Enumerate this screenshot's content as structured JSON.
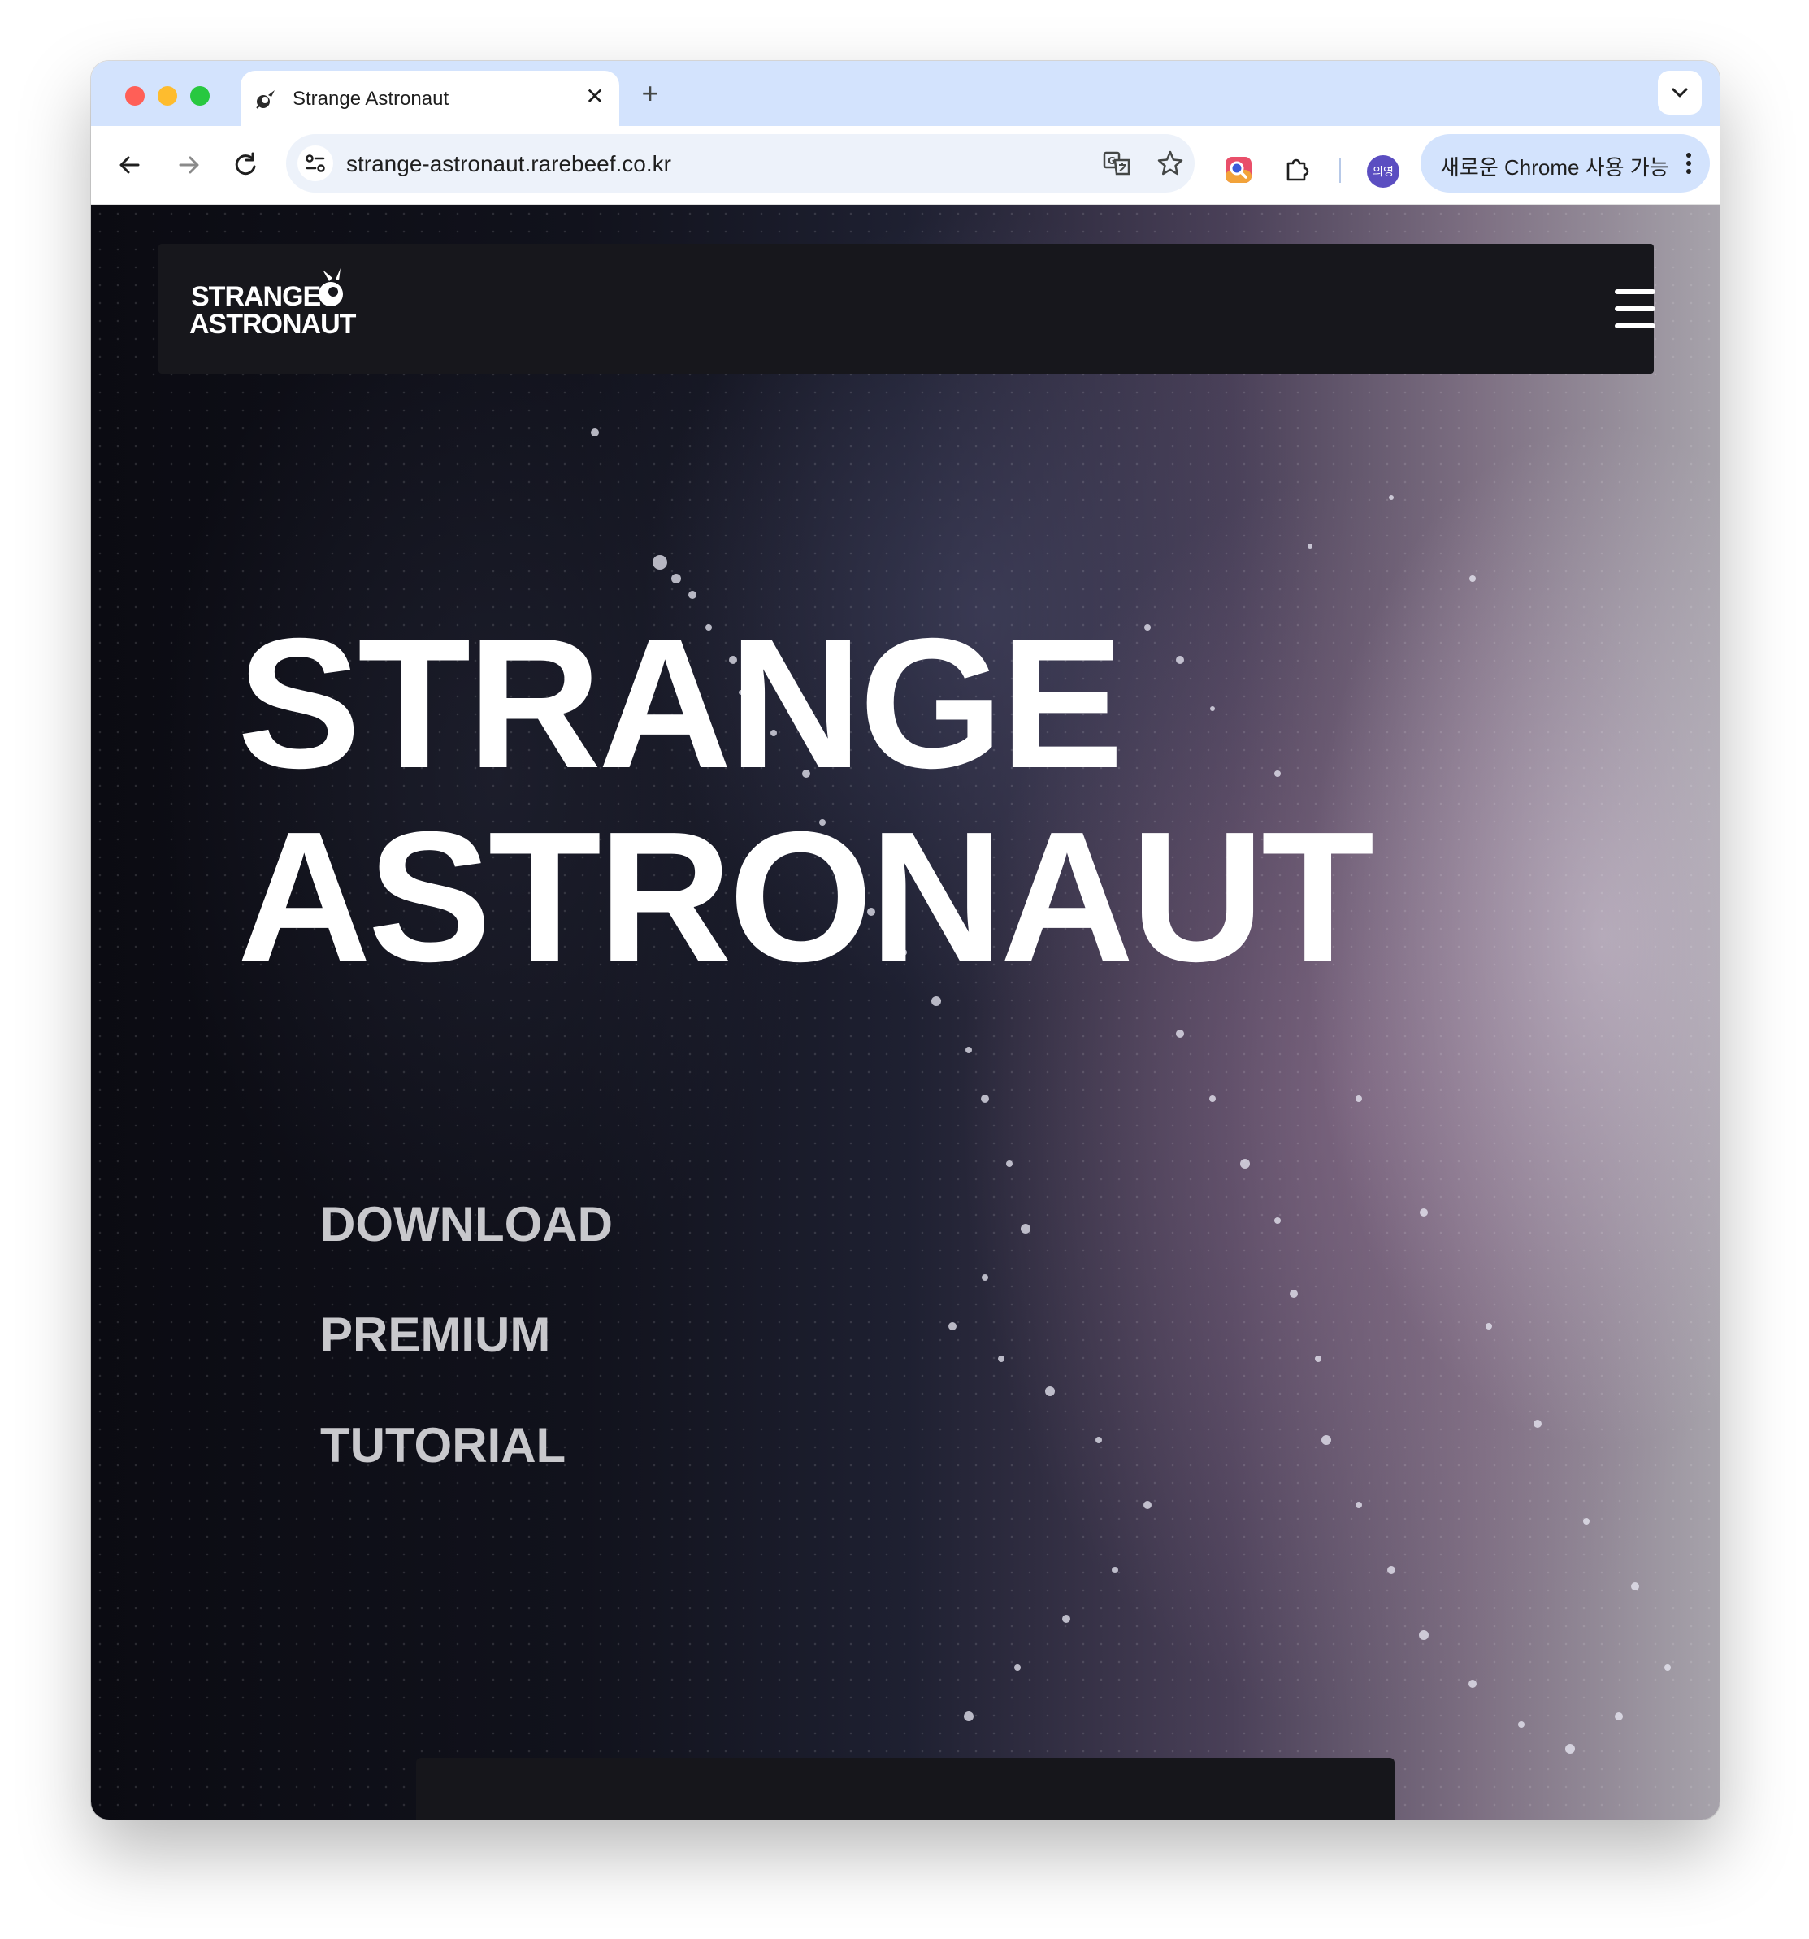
{
  "browser": {
    "tab": {
      "title": "Strange Astronaut",
      "close_label": "✕"
    },
    "new_tab_label": "+",
    "address": {
      "url": "strange-astronaut.rarebeef.co.kr"
    },
    "profile_label": "의영",
    "update_label": "새로운 Chrome 사용 가능"
  },
  "site": {
    "logo": {
      "line1": "STRANGE",
      "line2": "ASTRONAUT"
    },
    "hero": {
      "line1": "STRANGE",
      "line2": "ASTRONAUT"
    },
    "menu": [
      {
        "label": "DOWNLOAD"
      },
      {
        "label": "PREMIUM"
      },
      {
        "label": "TUTORIAL"
      }
    ]
  },
  "colors": {
    "tabstrip": "#d3e3fd",
    "omnibox": "#edf2fa",
    "nav_bar": "#17171c",
    "hero_text": "#ffffff",
    "menu_text": "#c8c8cc"
  }
}
